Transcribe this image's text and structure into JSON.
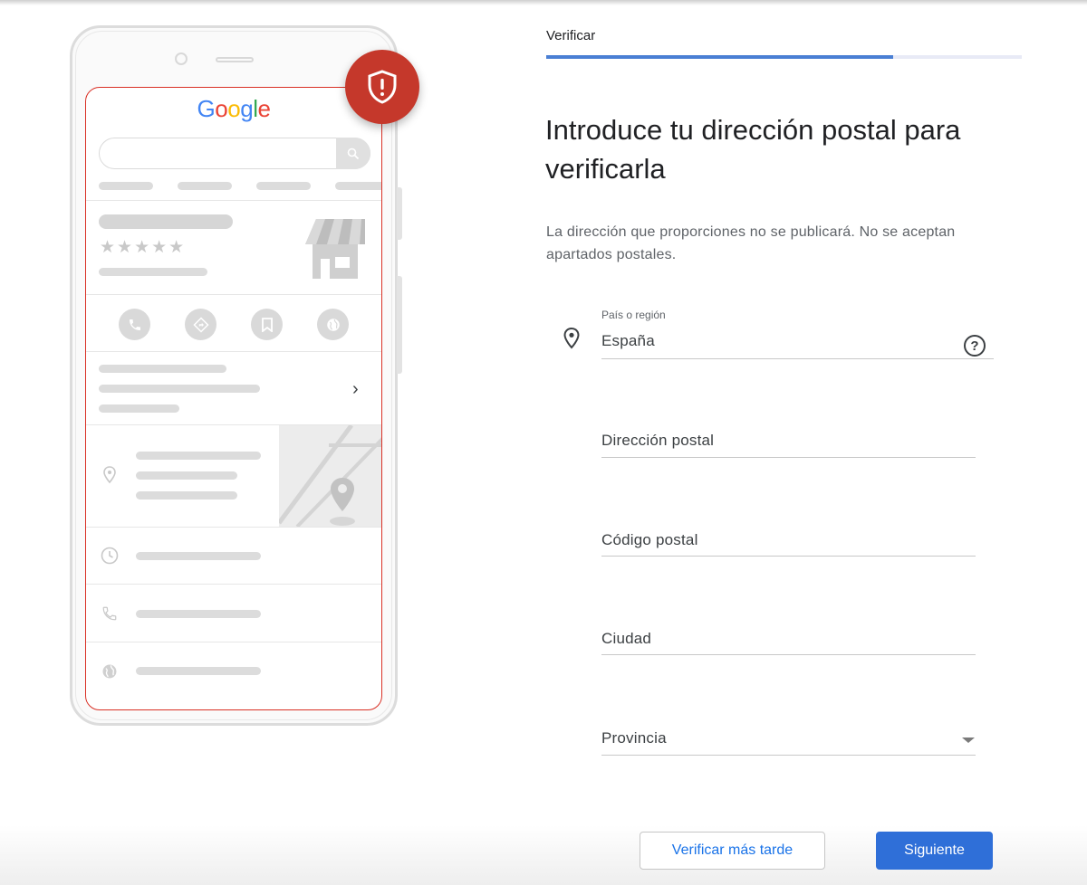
{
  "illustration": {
    "logo_letters": [
      "G",
      "o",
      "o",
      "g",
      "l",
      "e"
    ],
    "logo_colors": [
      "#4285F4",
      "#EA4335",
      "#FBBC05",
      "#4285F4",
      "#34A853",
      "#EA4335"
    ],
    "rating_stars": "★★★★★",
    "badge_icon": "shield-alert-icon",
    "badge_color": "#c5382b",
    "chevron": "›"
  },
  "header": {
    "step_label": "Verificar",
    "progress_percent": 73
  },
  "form": {
    "title": "Introduce tu dirección postal para verificarla",
    "subtitle": "La dirección que proporciones no se publicará. No se aceptan apartados postales.",
    "country": {
      "label": "País o región",
      "value": "España",
      "help_icon": "?"
    },
    "street": {
      "placeholder": "Dirección postal"
    },
    "postal_code": {
      "placeholder": "Código postal"
    },
    "city": {
      "placeholder": "Ciudad"
    },
    "province": {
      "placeholder": "Provincia"
    }
  },
  "actions": {
    "later_label": "Verificar más tarde",
    "next_label": "Siguiente"
  },
  "colors": {
    "accent": "#2f6fd8",
    "progress": "#4a7fd4",
    "alert_red": "#d93025"
  }
}
